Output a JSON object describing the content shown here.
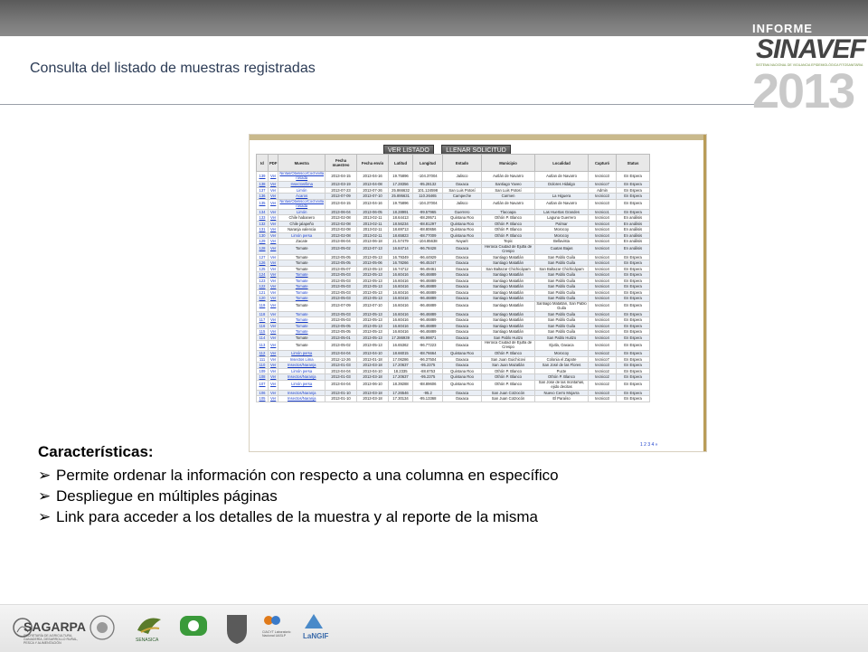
{
  "header": {
    "title": "Consulta del listado de muestras registradas",
    "logo": {
      "line1": "INFORME TECNICO",
      "line2": "SINAVEF",
      "line3": "SISTEMA NACIONAL DE VIGILANCIA EPIDEMIOLÓGICA FITOSANITARIA",
      "year": "2013"
    }
  },
  "screenshot": {
    "buttons": [
      "VER LISTADO",
      "LLENAR SOLICITUD"
    ],
    "columns": [
      "Id",
      "PDF",
      "Muestra",
      "Fecha muestreo",
      "Fecha envío",
      "Latitud",
      "Longitud",
      "Estado",
      "Municipio",
      "Localidad",
      "Capturó",
      "Status"
    ],
    "rows": [
      [
        "139",
        "Ver",
        "Ninfas/Obelisco/Cochinilla rosada",
        "2013-04-15",
        "2013-04-16",
        "19.75896",
        "-104.37004",
        "Jalisco",
        "Autlán de Navarro",
        "Autlan de Navarro",
        "tecnico3",
        "En Espera"
      ],
      [
        "138",
        "Ver",
        "Insectos/lima",
        "2013-03-19",
        "2013-04-08",
        "17.28356",
        "-95.28132",
        "Oaxaca",
        "Santiago Yaveo",
        "Dolores Hidalgo",
        "tecnico7",
        "En Espera"
      ],
      [
        "137",
        "Ver",
        "Limón",
        "2013-07-23",
        "2013-07-26",
        "25.866632",
        "101.124598",
        "San Luis Potosí",
        "San Luis Potosí",
        "",
        "Admin",
        "En Espera"
      ],
      [
        "136",
        "Ver",
        "Ácaros",
        "2013-07-09",
        "2013-07-10",
        "25.895631",
        "110.26465",
        "Campeche",
        "Carmen",
        "La Higuera",
        "tecnico3",
        "En Espera"
      ],
      [
        "135",
        "Ver",
        "Ninfas/Obelisco/Cochinilla rosada",
        "2013-04-15",
        "2013-04-16",
        "19.75896",
        "-104.37004",
        "Jalisco",
        "Autlán de Navarro",
        "Autlan de Navarro",
        "tecnico3",
        "En Espera"
      ],
      [
        "134",
        "Ver",
        "Limón",
        "2013-06-04",
        "2013-06-05",
        "18.28991",
        "-99.57965",
        "Guerrero",
        "Tlacoapa",
        "Las Huertas Grandes",
        "tecnico1",
        "En Espera"
      ],
      [
        "133",
        "Ver",
        "Chile habanero",
        "2013-02-08",
        "2013-02-11",
        "18.64413",
        "-88.29571",
        "Quintana Roo",
        "Othón P. Blanco",
        "Laguna Guerrero",
        "tecnico4",
        "En análisis"
      ],
      [
        "132",
        "Ver",
        "Chile jalapeño",
        "2013-02-08",
        "2013-02-11",
        "18.56234",
        "-88.81297",
        "Quintana Roo",
        "Othón P. Blanco",
        "Palmar",
        "tecnico4",
        "En análisis"
      ],
      [
        "131",
        "Ver",
        "Naranja valencia",
        "2013-02-08",
        "2013-02-11",
        "18.69713",
        "-88.80656",
        "Quintana Roo",
        "Othón P. Blanco",
        "Morocoy",
        "tecnico4",
        "En análisis"
      ],
      [
        "130",
        "Ver",
        "Limón persa",
        "2013-02-08",
        "2013-02-11",
        "18.65823",
        "-88.77009",
        "Quintana Roo",
        "Othón P. Blanco",
        "Morocoy",
        "tecnico4",
        "En análisis"
      ],
      [
        "129",
        "Ver",
        "Zacate",
        "2013-06-04",
        "2013-06-18",
        "21.57479",
        "-104.85638",
        "Nayarit",
        "Tepic",
        "Bellavista",
        "tecnico4",
        "En análisis"
      ],
      [
        "128",
        "Ver",
        "Tomate",
        "2013-05-02",
        "2013-07-13",
        "16.84714",
        "-96.78428",
        "Oaxaca",
        "Heroica Ciudad de Ejutla de Crespo",
        "Cuatas Bajas",
        "tecnico4",
        "En análisis"
      ],
      [
        "127",
        "Ver",
        "Tomate",
        "2013-05-05",
        "2013-05-13",
        "16.79349",
        "-96.44929",
        "Oaxaca",
        "Santiago Matatlán",
        "San Pablo Guila",
        "tecnico4",
        "En Espera"
      ],
      [
        "126",
        "Ver",
        "Tomate",
        "2013-05-05",
        "2013-05-06",
        "16.78266",
        "-96.45347",
        "Oaxaca",
        "Santiago Matatlán",
        "San Pablo Guila",
        "tecnico4",
        "En Espera"
      ],
      [
        "125",
        "Ver",
        "Tomate",
        "2013-05-07",
        "2013-05-13",
        "16.74712",
        "-96.49461",
        "Oaxaca",
        "San Baltazar Chichicápam",
        "San Baltazar Chichicápam",
        "tecnico4",
        "En Espera"
      ],
      [
        "124",
        "Ver",
        "Tomate",
        "2013-05-03",
        "2013-05-13",
        "16.60416",
        "-96.46889",
        "Oaxaca",
        "Santiago Matatlán",
        "San Pablo Guila",
        "tecnico4",
        "En Espera"
      ],
      [
        "123",
        "Ver",
        "Tomate",
        "2013-05-03",
        "2013-05-13",
        "16.60416",
        "-96.46889",
        "Oaxaca",
        "Santiago Matatlán",
        "San Pablo Guila",
        "tecnico4",
        "En Espera"
      ],
      [
        "122",
        "Ver",
        "Tomate",
        "2013-05-03",
        "2013-05-13",
        "16.60416",
        "-96.46889",
        "Oaxaca",
        "Santiago Matatlán",
        "San Pablo Guila",
        "tecnico4",
        "En Espera"
      ],
      [
        "121",
        "Ver",
        "Tomate",
        "2013-05-03",
        "2013-05-13",
        "16.60416",
        "-96.46889",
        "Oaxaca",
        "Santiago Matatlán",
        "San Pablo Guila",
        "tecnico4",
        "En Espera"
      ],
      [
        "120",
        "Ver",
        "Tomate",
        "2013-05-03",
        "2013-05-13",
        "16.60416",
        "-96.46889",
        "Oaxaca",
        "Santiago Matatlán",
        "San Pablo Guila",
        "tecnico4",
        "En Espera"
      ],
      [
        "119",
        "Ver",
        "Tomate",
        "2013-07-09",
        "2013-07-10",
        "16.60416",
        "-96.46889",
        "Oaxaca",
        "Santiago Matatlán",
        "Santiago Matatlán, San Pablo Guila",
        "tecnico4",
        "En Espera"
      ],
      [
        "118",
        "Ver",
        "Tomate",
        "2013-05-03",
        "2013-05-13",
        "16.60416",
        "-96.46889",
        "Oaxaca",
        "Santiago Matatlán",
        "San Pablo Guila",
        "tecnico4",
        "En Espera"
      ],
      [
        "117",
        "Ver",
        "Tomate",
        "2013-05-03",
        "2013-05-13",
        "16.60416",
        "-96.46889",
        "Oaxaca",
        "Santiago Matatlán",
        "San Pablo Guila",
        "tecnico4",
        "En Espera"
      ],
      [
        "116",
        "Ver",
        "Tomate",
        "2013-05-05",
        "2013-05-13",
        "16.60416",
        "-96.46889",
        "Oaxaca",
        "Santiago Matatlán",
        "San Pablo Guila",
        "tecnico4",
        "En Espera"
      ],
      [
        "115",
        "Ver",
        "Tomate",
        "2013-05-05",
        "2013-05-13",
        "16.60416",
        "-96.46889",
        "Oaxaca",
        "Santiago Matatlán",
        "San Pablo Guila",
        "tecnico4",
        "En Espera"
      ],
      [
        "114",
        "Ver",
        "Tomate",
        "2013-05-01",
        "2013-05-13",
        "17.286939",
        "-95.99871",
        "Oaxaca",
        "San Pablo Huitzo",
        "San Pablo Huitzo",
        "tecnico4",
        "En Espera"
      ],
      [
        "113",
        "Ver",
        "Tomate",
        "2013-05-02",
        "2013-05-13",
        "16.65362",
        "-96.77223",
        "Oaxaca",
        "Heroica Ciudad de Ejutla de Crespo",
        "Ejutla, Oaxaca",
        "tecnico4",
        "En Espera"
      ],
      [
        "112",
        "Ver",
        "Limón persa",
        "2013-04-04",
        "2013-04-10",
        "18.66015",
        "-88.76664",
        "Quintana Roo",
        "Othón P. Blanco",
        "Morocoy",
        "tecnico2",
        "En Espera"
      ],
      [
        "111",
        "Ver",
        "Insectos Lima",
        "2012-12-26",
        "2013-01-18",
        "17.06286",
        "-96.37504",
        "Oaxaca",
        "San Juan Guichicovi",
        "Colonia el Zapote",
        "tecnico7",
        "En Espera"
      ],
      [
        "110",
        "Ver",
        "Insectos/Naranja",
        "2013-01-03",
        "2013-03-18",
        "17.20637",
        "-95.2375",
        "Oaxaca",
        "San Juan Mazatlán",
        "San José de las Flores",
        "tecnico3",
        "En Espera"
      ],
      [
        "109",
        "Ver",
        "Limón persa",
        "2013-04-04",
        "2013-04-10",
        "18.2335",
        "-88.6753",
        "Quintana Roo",
        "Othón P. Blanco",
        "Pucte",
        "tecnico2",
        "En Espera"
      ],
      [
        "108",
        "Ver",
        "Insectos/Naranja",
        "2013-01-03",
        "2013-03-18",
        "17.20637",
        "-95.2375",
        "Quintana Roo",
        "Othón P. Blanco",
        "Othón P. Blanco",
        "tecnico2",
        "En Espera"
      ],
      [
        "107",
        "Ver",
        "Limón persa",
        "2013-04-04",
        "2013-06-10",
        "18.39288",
        "-88.89606",
        "Quintana Roo",
        "Othón P. Blanco",
        "San José de las montañas, ejido decitas",
        "tecnico2",
        "En Espera"
      ],
      [
        "106",
        "Ver",
        "Insectos/Naranja",
        "2013-01-10",
        "2013-03-18",
        "17.26546",
        "-95.2",
        "Oaxaca",
        "San Juan Cotzocón",
        "Nuevo Cerro Mojarra",
        "tecnico3",
        "En Espera"
      ],
      [
        "105",
        "Ver",
        "Insectos/Naranja",
        "2013-01-10",
        "2013-03-18",
        "17.30134",
        "-95.13368",
        "Oaxaca",
        "San Juan Cotzocón",
        "El Paraíso",
        "tecnico3",
        "En Espera"
      ]
    ],
    "pager": "1 2 3 4 »"
  },
  "features": {
    "heading": "Características:",
    "items": [
      "Permite ordenar la información con respecto a una columna en específico",
      "Despliegue en múltiples páginas",
      "Link para acceder a los detalles de la muestra y al reporte de la misma"
    ]
  },
  "footer": {
    "sagarpa": "SAGARPA",
    "sagarpa_sub": "SECRETARÍA DE AGRICULTURA, GANADERÍA, DESARROLLO RURAL, PESCA Y ALIMENTACIÓN",
    "senasica": "SENASICA",
    "cesavep": "",
    "conacyt": "CIACYT Laboratorio Nacional UASLP",
    "langif": "LaNGIF"
  }
}
